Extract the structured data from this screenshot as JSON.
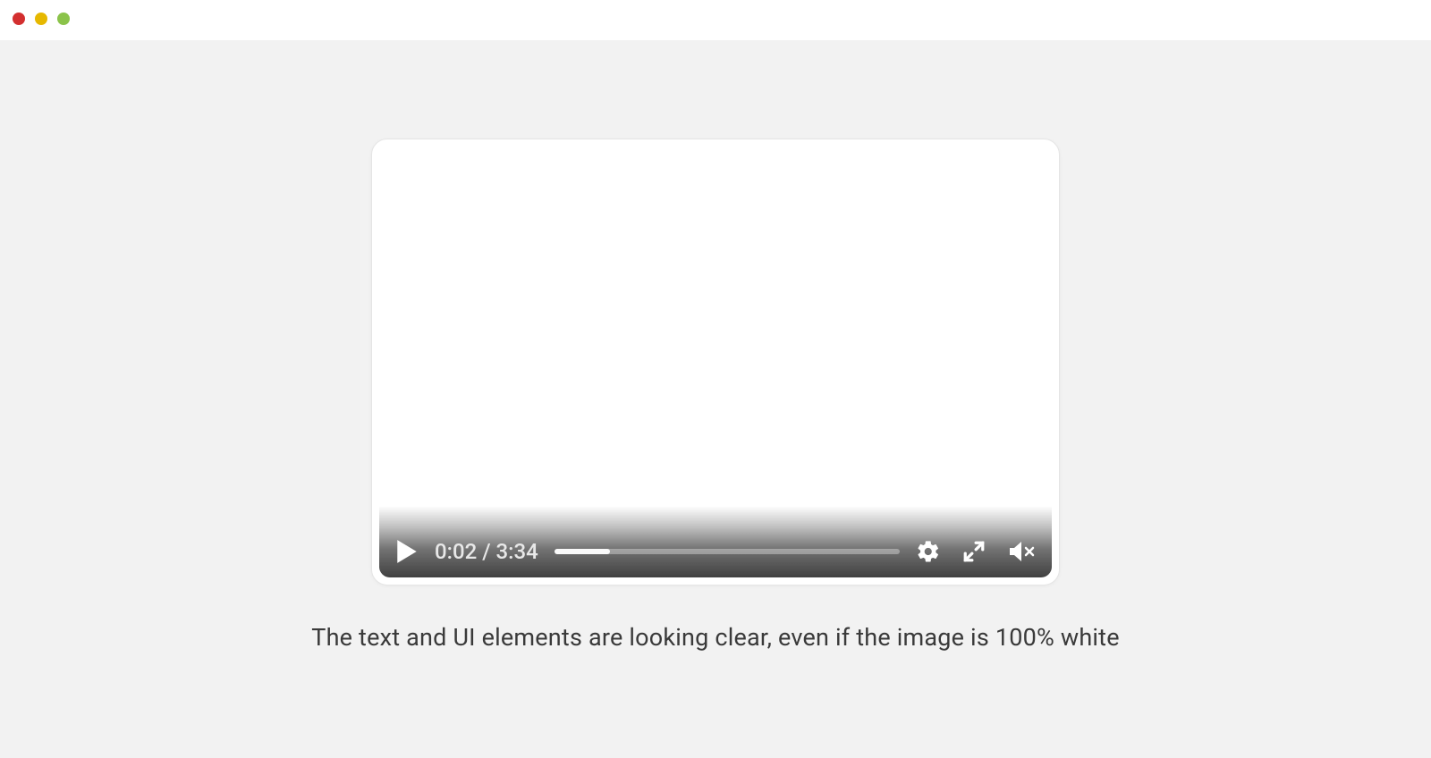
{
  "player": {
    "current_time": "0:02",
    "duration": "3:34",
    "time_display": "0:02 / 3:34",
    "progress_percent": 16
  },
  "caption": "The text and UI elements are looking clear, even if the image is 100% white",
  "icons": {
    "play": "play-icon",
    "settings": "gear-icon",
    "fullscreen": "fullscreen-icon",
    "mute": "volume-muted-icon"
  }
}
